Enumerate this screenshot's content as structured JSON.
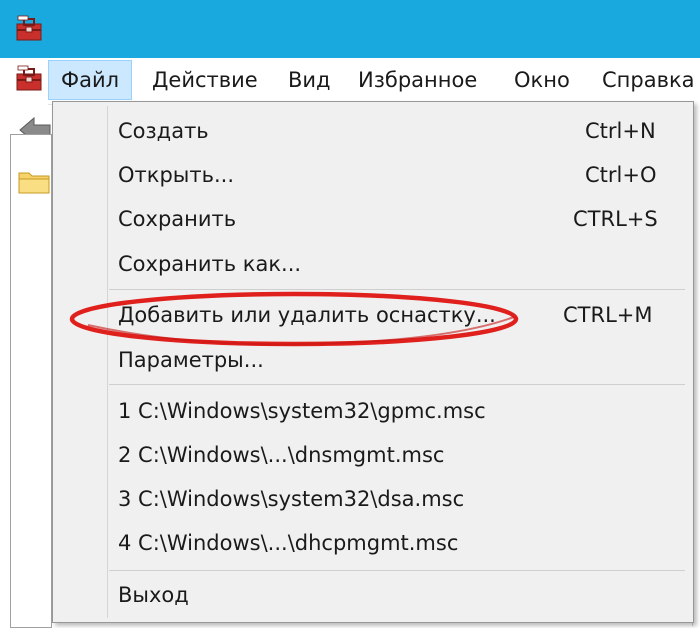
{
  "menubar": {
    "items": [
      {
        "label": "Файл"
      },
      {
        "label": "Действие"
      },
      {
        "label": "Вид"
      },
      {
        "label": "Избранное"
      },
      {
        "label": "Окно"
      },
      {
        "label": "Справка"
      }
    ]
  },
  "file_menu": {
    "items": [
      {
        "label": "Создать",
        "shortcut": "Ctrl+N"
      },
      {
        "label": "Открыть...",
        "shortcut": "Ctrl+O"
      },
      {
        "label": "Сохранить",
        "shortcut": "CTRL+S"
      },
      {
        "label": "Сохранить как...",
        "shortcut": ""
      },
      {
        "label": "Добавить или удалить оснастку...",
        "shortcut": "CTRL+M"
      },
      {
        "label": "Параметры...",
        "shortcut": ""
      }
    ],
    "recent": [
      {
        "label": "1 C:\\Windows\\system32\\gpmc.msc"
      },
      {
        "label": "2 C:\\Windows\\...\\dnsmgmt.msc"
      },
      {
        "label": "3 C:\\Windows\\system32\\dsa.msc"
      },
      {
        "label": "4 C:\\Windows\\...\\dhcpmgmt.msc"
      }
    ],
    "exit_label": "Выход"
  },
  "colors": {
    "titlebar": "#19a9de",
    "active_menu_bg": "#cce8ff",
    "highlight_ellipse": "#e0201c"
  },
  "icons": [
    "mmc-toolbox-icon",
    "back-arrow-icon",
    "folder-icon"
  ]
}
